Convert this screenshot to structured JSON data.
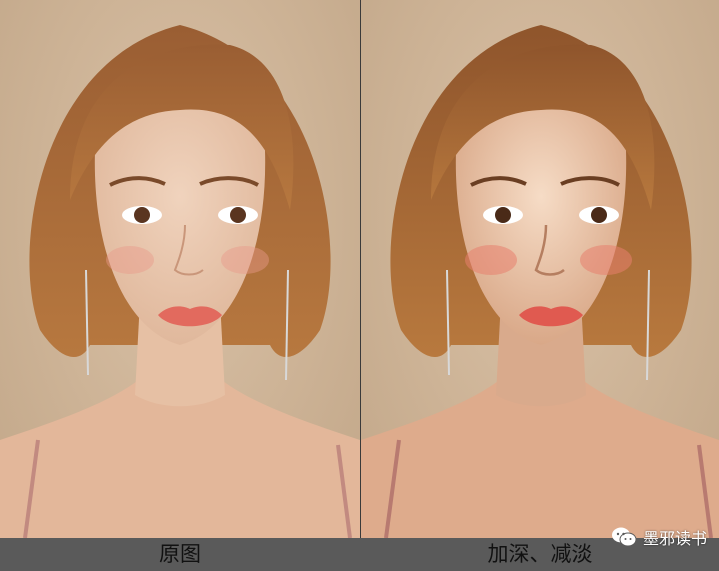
{
  "panels": [
    {
      "caption": "原图",
      "variant": "original"
    },
    {
      "caption": "加深、减淡",
      "variant": "dodge-burn"
    }
  ],
  "watermark": {
    "text": "墨邪读书",
    "icon": "wechat-icon"
  },
  "colors": {
    "background": "#cdb396",
    "hair": "#a8693a",
    "skin": "#e8c4a8",
    "lips": "#e26a5e",
    "caption_bar": "#5a5a5a"
  }
}
